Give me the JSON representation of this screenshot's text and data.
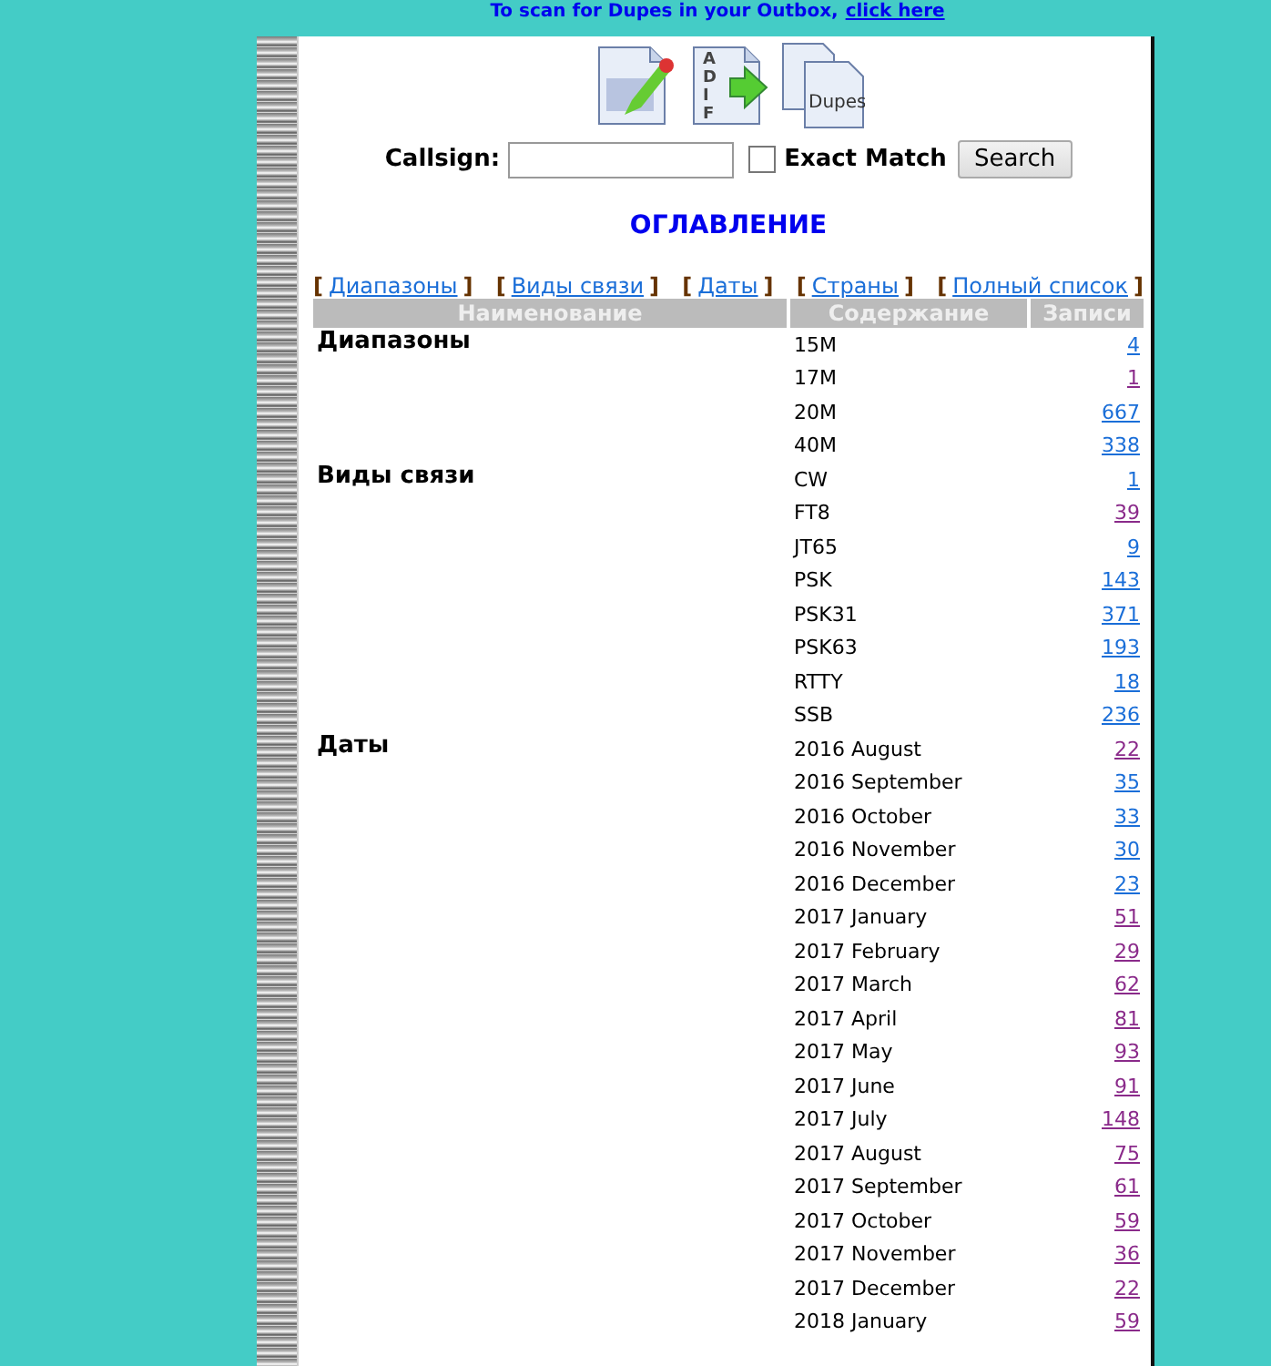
{
  "notice": {
    "text": "To scan for Dupes in your Outbox,",
    "link": "click here"
  },
  "toolbar": [
    {
      "kind": "edit"
    },
    {
      "kind": "adif",
      "letters": [
        "A",
        "D",
        "I",
        "F"
      ]
    },
    {
      "kind": "dupes",
      "label": "Dupes"
    }
  ],
  "search": {
    "label": "Callsign:",
    "exact_match": {
      "label": "Exact Match",
      "checked": false
    },
    "button": "Search"
  },
  "title": "ОГЛАВЛЕНИЕ",
  "nav": [
    {
      "open": "[",
      "label": "Диапазоны",
      "close": "]"
    },
    {
      "open": "[",
      "label": "Виды связи",
      "close": "]"
    },
    {
      "open": "[",
      "label": "Даты",
      "close": "]"
    },
    {
      "open": "[",
      "label": "Страны",
      "close": "]"
    },
    {
      "open": "[",
      "label": "Полный список",
      "close": "]"
    }
  ],
  "table": {
    "columns": [
      "Наименование",
      "Содержание",
      "Записи"
    ],
    "groups": [
      {
        "name": "Диапазоны",
        "rows": [
          {
            "item": "15M",
            "count": "4",
            "visited": false
          },
          {
            "item": "17M",
            "count": "1",
            "visited": true
          },
          {
            "item": "20M",
            "count": "667",
            "visited": false
          },
          {
            "item": "40M",
            "count": "338",
            "visited": false
          }
        ]
      },
      {
        "name": "Виды связи",
        "rows": [
          {
            "item": "CW",
            "count": "1",
            "visited": false
          },
          {
            "item": "FT8",
            "count": "39",
            "visited": true
          },
          {
            "item": "JT65",
            "count": "9",
            "visited": false
          },
          {
            "item": "PSK",
            "count": "143",
            "visited": false
          },
          {
            "item": "PSK31",
            "count": "371",
            "visited": false
          },
          {
            "item": "PSK63",
            "count": "193",
            "visited": false
          },
          {
            "item": "RTTY",
            "count": "18",
            "visited": false
          },
          {
            "item": "SSB",
            "count": "236",
            "visited": false
          }
        ]
      },
      {
        "name": "Даты",
        "rows": [
          {
            "item": "2016 August",
            "count": "22",
            "visited": true
          },
          {
            "item": "2016 September",
            "count": "35",
            "visited": false
          },
          {
            "item": "2016 October",
            "count": "33",
            "visited": false
          },
          {
            "item": "2016 November",
            "count": "30",
            "visited": false
          },
          {
            "item": "2016 December",
            "count": "23",
            "visited": false
          },
          {
            "item": "2017 January",
            "count": "51",
            "visited": true
          },
          {
            "item": "2017 February",
            "count": "29",
            "visited": true
          },
          {
            "item": "2017 March",
            "count": "62",
            "visited": true
          },
          {
            "item": "2017 April",
            "count": "81",
            "visited": true
          },
          {
            "item": "2017 May",
            "count": "93",
            "visited": true
          },
          {
            "item": "2017 June",
            "count": "91",
            "visited": true
          },
          {
            "item": "2017 July",
            "count": "148",
            "visited": true
          },
          {
            "item": "2017 August",
            "count": "75",
            "visited": true
          },
          {
            "item": "2017 September",
            "count": "61",
            "visited": true
          },
          {
            "item": "2017 October",
            "count": "59",
            "visited": true
          },
          {
            "item": "2017 November",
            "count": "36",
            "visited": true
          },
          {
            "item": "2017 December",
            "count": "22",
            "visited": true
          },
          {
            "item": "2018 January",
            "count": "59",
            "visited": true
          }
        ]
      }
    ]
  }
}
